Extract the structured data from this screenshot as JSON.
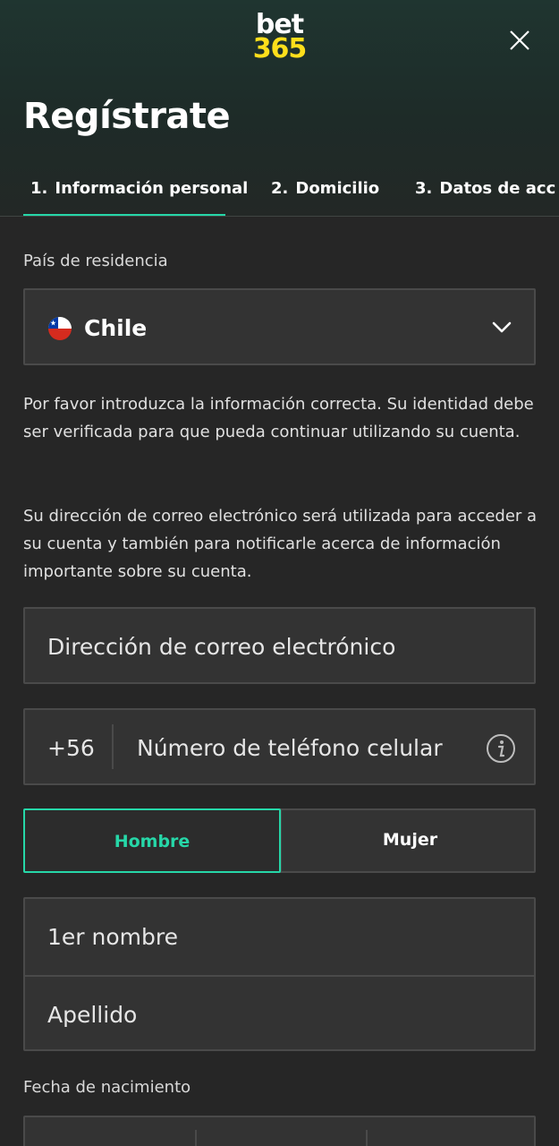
{
  "header": {
    "logo_top": "bet",
    "logo_bottom": "365",
    "close_icon": "close-icon"
  },
  "page_title": "Regístrate",
  "tabs": [
    {
      "num": "1.",
      "label": "Información personal",
      "active": true
    },
    {
      "num": "2.",
      "label": "Domicilio",
      "active": false
    },
    {
      "num": "3.",
      "label": "Datos de acc",
      "active": false
    }
  ],
  "country": {
    "label": "País de residencia",
    "value": "Chile",
    "flag_icon": "chile-flag-icon",
    "chevron_icon": "chevron-down-icon"
  },
  "info_text_1": "Por favor introduzca la información correcta. Su identidad debe ser verificada para que pueda continuar utilizando su cuenta.",
  "info_text_2": "Su dirección de correo electrónico será utilizada para acceder a su cuenta y también para notificarle acerca de información importante sobre su cuenta.",
  "email": {
    "placeholder": "Dirección de correo electrónico"
  },
  "phone": {
    "prefix": "+56",
    "placeholder": "Número de teléfono celular",
    "info_icon": "info-icon"
  },
  "gender": {
    "options": [
      "Hombre",
      "Mujer"
    ],
    "selected": "Hombre"
  },
  "name": {
    "first_placeholder": "1er nombre",
    "last_placeholder": "Apellido"
  },
  "dob": {
    "label": "Fecha de nacimiento"
  },
  "colors": {
    "accent": "#26d7a8",
    "logo_yellow": "#ffdf1b",
    "background": "#262626",
    "field_bg": "#333333"
  }
}
